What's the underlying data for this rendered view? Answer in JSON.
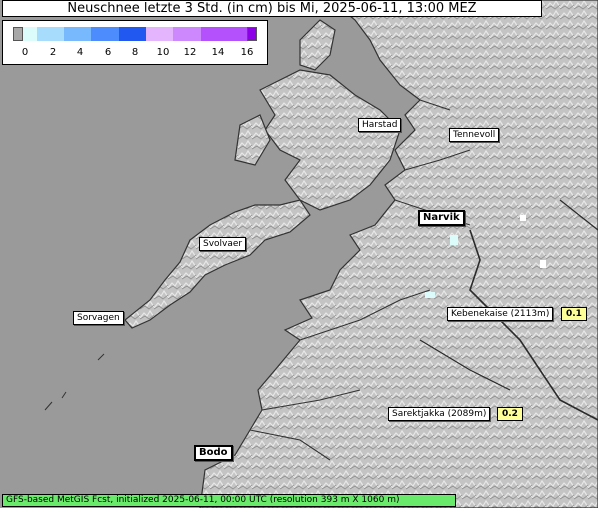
{
  "title": "Neuschnee letzte 3 Std. (in cm) bis Mi, 2025-06-11, 13:00 MEZ",
  "legend": {
    "ticks": [
      "0",
      "2",
      "4",
      "6",
      "8",
      "10",
      "12",
      "14",
      "16"
    ],
    "colors": [
      "#a8a8a8",
      "#dcfcfc",
      "#a8dcfc",
      "#78b8fc",
      "#4c8cfc",
      "#2058f0",
      "#e4b4fc",
      "#cc88fc",
      "#b450fc",
      "#8c00e8"
    ]
  },
  "places": [
    {
      "name": "Harstad",
      "bold": false
    },
    {
      "name": "Tennevoll",
      "bold": false
    },
    {
      "name": "Narvik",
      "bold": true
    },
    {
      "name": "Svolvaer",
      "bold": false
    },
    {
      "name": "Sorvagen",
      "bold": false
    },
    {
      "name": "Kebenekaise (2113m)",
      "bold": false,
      "value": "0.1"
    },
    {
      "name": "Sarektjakka (2089m)",
      "bold": false,
      "value": "0.2"
    },
    {
      "name": "Bodo",
      "bold": true
    }
  ],
  "footer": "GFS-based MetGIS Fcst, initialized 2025-06-11, 00:00 UTC  (resolution 393 m X 1060 m)",
  "colors": {
    "sea": "#9a9a9a",
    "land": "#c8c8c8",
    "footer_bg": "#6aea6a",
    "value_bg": "#ffff9a"
  }
}
